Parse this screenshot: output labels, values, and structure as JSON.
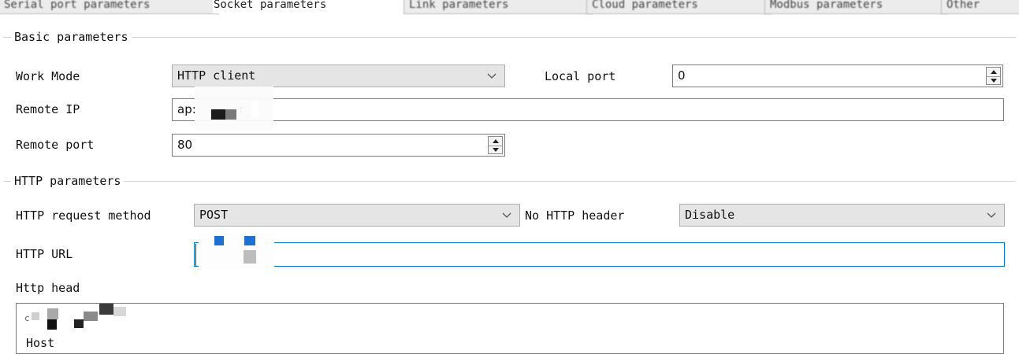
{
  "tabs": [
    {
      "label": "Serial port parameters",
      "active": false
    },
    {
      "label": "Socket parameters",
      "active": true
    },
    {
      "label": "Link parameters",
      "active": false
    },
    {
      "label": "Cloud parameters",
      "active": false
    },
    {
      "label": "Modbus parameters",
      "active": false
    },
    {
      "label": "Other",
      "active": false
    }
  ],
  "basic": {
    "legend": "Basic parameters",
    "work_mode_label": "Work Mode",
    "work_mode_value": "HTTP client",
    "local_port_label": "Local port",
    "local_port_value": "0",
    "remote_ip_label": "Remote IP",
    "remote_ip_visible_start": "ap:",
    "remote_ip_visible_end": "r",
    "remote_port_label": "Remote port",
    "remote_port_value": "80"
  },
  "http": {
    "legend": "HTTP parameters",
    "method_label": "HTTP request method",
    "method_value": "POST",
    "no_header_label": "No HTTP header",
    "no_header_value": "Disable",
    "url_label": "HTTP URL",
    "head_label": "Http head",
    "head_text_first_char": "c",
    "head_text_line2": "Host"
  },
  "icons": {
    "dropdown": "chevron-down-icon",
    "spinner": "spinner-icon",
    "redaction": "redaction-block"
  }
}
